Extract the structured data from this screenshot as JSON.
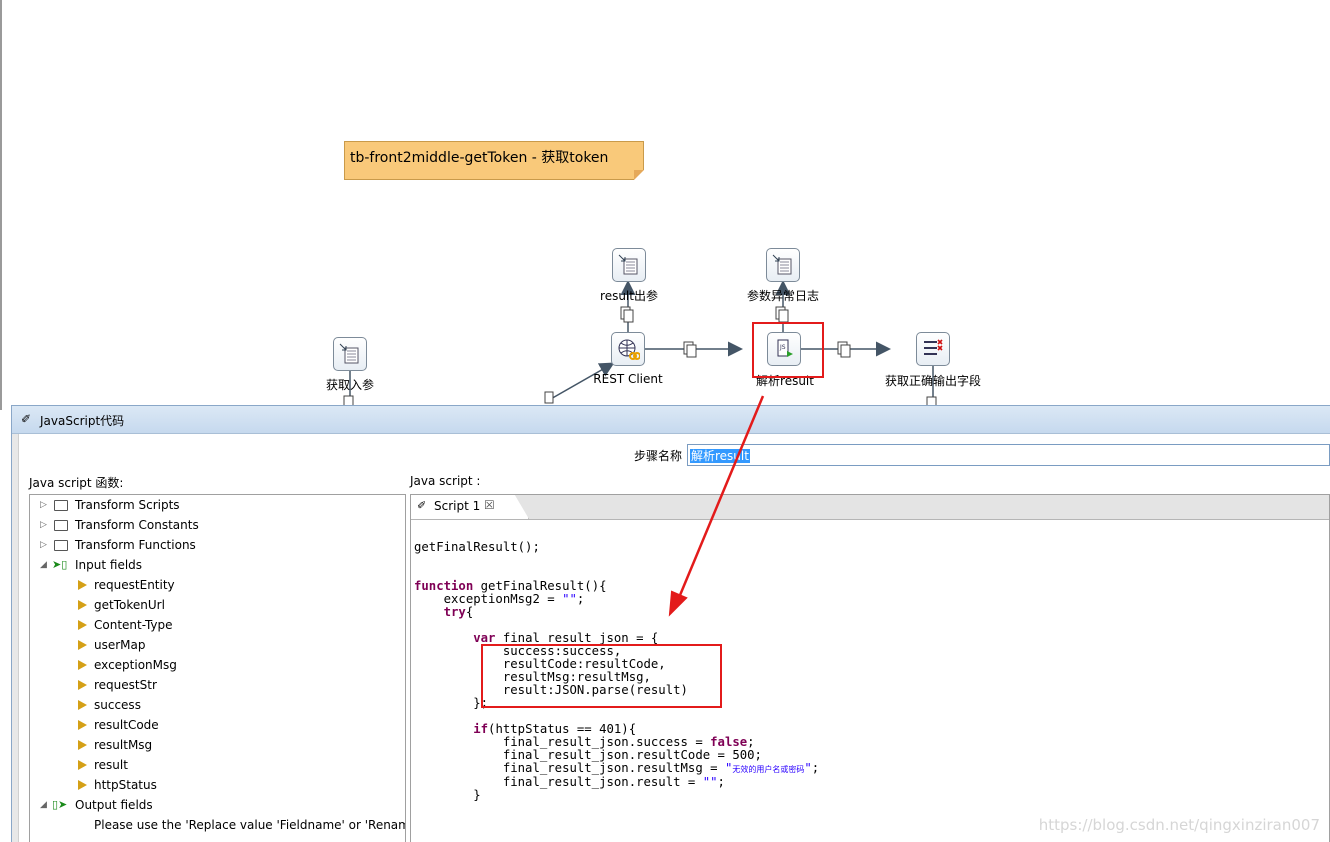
{
  "canvas": {
    "note": "tb-front2middle-getToken - 获取token",
    "steps": [
      {
        "label": "result出参",
        "icon": "output-table-icon"
      },
      {
        "label": "参数异常日志",
        "icon": "output-table-icon"
      },
      {
        "label": "获取入参",
        "icon": "input-table-icon"
      },
      {
        "label": "REST Client",
        "icon": "rest-client-icon"
      },
      {
        "label": "解析result",
        "icon": "javascript-icon"
      },
      {
        "label": "获取正确输出字段",
        "icon": "select-values-icon"
      }
    ],
    "highlight_color": "#e31b1b"
  },
  "dialog": {
    "title": "JavaScript代码",
    "step_name_label": "步骤名称",
    "step_name_value": "解析result",
    "functions_label": "Java script 函数:",
    "script_label": "Java script :",
    "tree": [
      {
        "label": "Transform Scripts",
        "type": "folder",
        "expanded": false
      },
      {
        "label": "Transform Constants",
        "type": "folder",
        "expanded": false
      },
      {
        "label": "Transform Functions",
        "type": "folder",
        "expanded": false
      },
      {
        "label": "Input fields",
        "type": "input",
        "expanded": true
      },
      {
        "label": "requestEntity",
        "type": "field"
      },
      {
        "label": "getTokenUrl",
        "type": "field"
      },
      {
        "label": "Content-Type",
        "type": "field"
      },
      {
        "label": "userMap",
        "type": "field"
      },
      {
        "label": "exceptionMsg",
        "type": "field"
      },
      {
        "label": "requestStr",
        "type": "field"
      },
      {
        "label": "success",
        "type": "field"
      },
      {
        "label": "resultCode",
        "type": "field"
      },
      {
        "label": "resultMsg",
        "type": "field"
      },
      {
        "label": "result",
        "type": "field"
      },
      {
        "label": "httpStatus",
        "type": "field"
      },
      {
        "label": "Output fields",
        "type": "output",
        "expanded": true
      },
      {
        "label": "Please use the 'Replace value 'Fieldname' or 'Rename",
        "type": "hint"
      }
    ],
    "tab_label": "Script 1",
    "code_lines": [
      "getFinalResult();",
      "",
      "",
      "function getFinalResult(){",
      "    exceptionMsg2 = \"\";",
      "    try{",
      "",
      "        var final_result_json = {",
      "            success:success,",
      "            resultCode:resultCode,",
      "            resultMsg:resultMsg,",
      "            result:JSON.parse(result)",
      "        };",
      "",
      "        if(httpStatus == 401){",
      "            final_result_json.success = false;",
      "            final_result_json.resultCode = 500;",
      "            final_result_json.resultMsg = \"无效的用户名或密码\";",
      "            final_result_json.result = \"\";",
      "        }"
    ]
  },
  "watermark": "https://blog.csdn.net/qingxinziran007"
}
